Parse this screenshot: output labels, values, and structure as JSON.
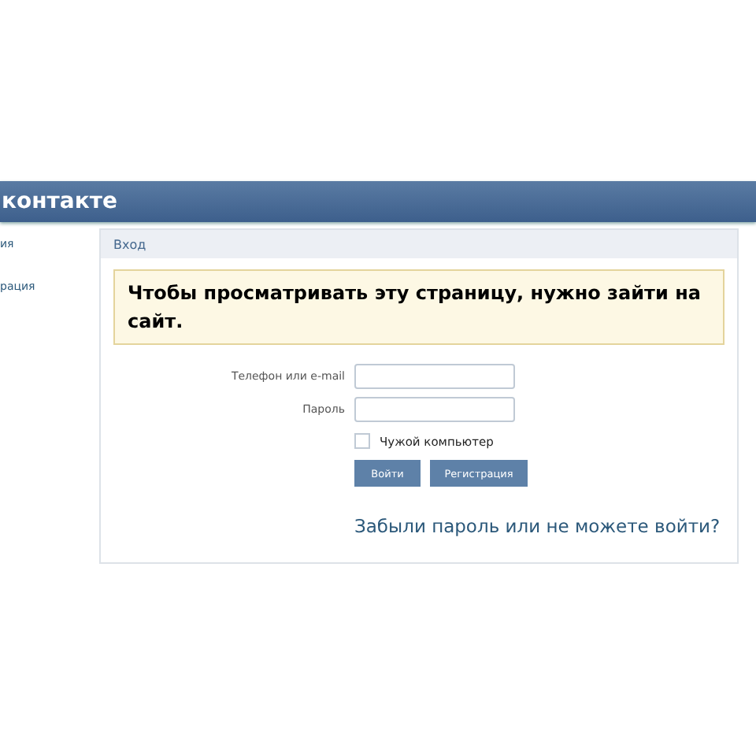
{
  "header": {
    "logo": "контакте"
  },
  "sidebar": {
    "items": [
      {
        "label": "ия"
      },
      {
        "label": "рация"
      }
    ]
  },
  "panel": {
    "title": "Вход",
    "notice": "Чтобы просматривать эту страницу, нужно зайти на сайт.",
    "fields": [
      {
        "label": "Телефон или e-mail"
      },
      {
        "label": "Пароль"
      }
    ],
    "remember": {
      "label": "Чужой компьютер",
      "checked": false
    },
    "buttons": [
      "Войти",
      "Регистрация"
    ],
    "forgot_link": "Забыли пароль или не можете войти?"
  }
}
